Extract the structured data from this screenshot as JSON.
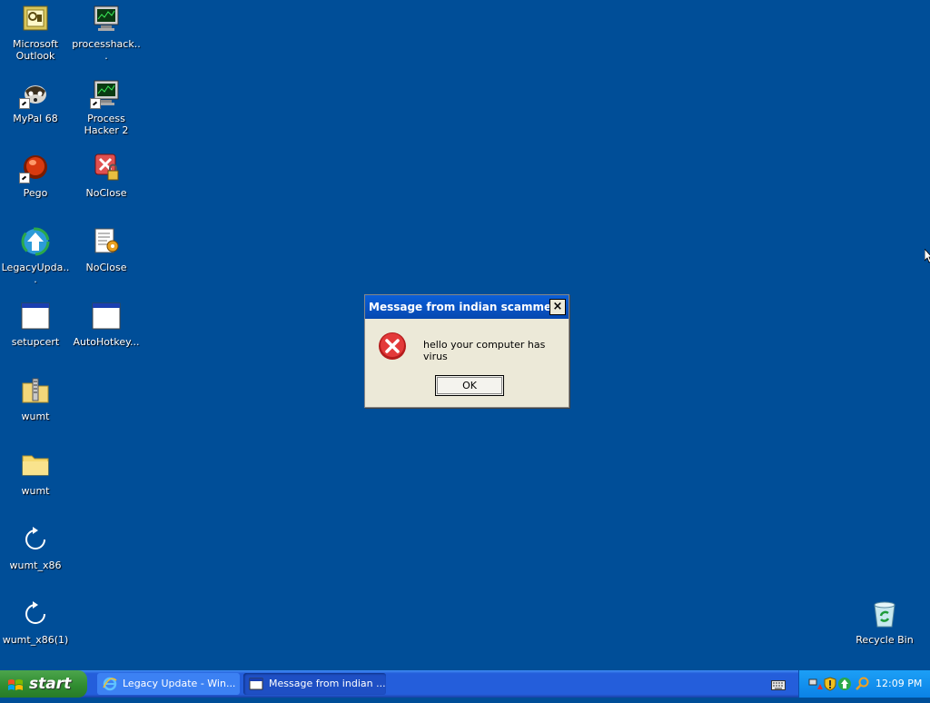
{
  "desktop": {
    "icons": [
      {
        "label": "Microsoft Outlook",
        "icon": "outlook-icon"
      },
      {
        "label": "processhack...",
        "icon": "process-hacker-icon"
      },
      {
        "label": "MyPal 68",
        "icon": "mypal-icon"
      },
      {
        "label": "Process Hacker 2",
        "icon": "process-hacker-icon"
      },
      {
        "label": "Pego",
        "icon": "pego-icon"
      },
      {
        "label": "NoClose",
        "icon": "noclose-icon"
      },
      {
        "label": "LegacyUpda...",
        "icon": "legacy-update-icon"
      },
      {
        "label": "NoClose",
        "icon": "noclose-script-icon"
      },
      {
        "label": "setupcert",
        "icon": "window-icon"
      },
      {
        "label": "AutoHotkey...",
        "icon": "window-icon"
      },
      {
        "label": "wumt",
        "icon": "zip-folder-icon"
      },
      {
        "label": "wumt",
        "icon": "folder-icon"
      },
      {
        "label": "wumt_x86",
        "icon": "refresh-icon"
      },
      {
        "label": "wumt_x86(1)",
        "icon": "refresh-icon"
      },
      {
        "label": "Recycle Bin",
        "icon": "recycle-bin-icon"
      }
    ]
  },
  "dialog": {
    "title": "Message from indian scammer",
    "close_label": "×",
    "message": "hello your computer has virus",
    "ok_label": "OK",
    "icon": "error-icon"
  },
  "taskbar": {
    "start_label": "start",
    "tasks": [
      {
        "label": "Legacy Update - Win...",
        "icon": "internet-explorer-icon"
      },
      {
        "label": "Message from indian ...",
        "icon": "window-icon"
      }
    ],
    "clock": "12:09 PM"
  },
  "colors": {
    "desktop": "#004e98",
    "taskbar": "#245edb",
    "start": "#2f8b2f",
    "tray": "#0b82e6",
    "dialog_title": "#0a5fd8",
    "dialog_body": "#ece9d8"
  }
}
